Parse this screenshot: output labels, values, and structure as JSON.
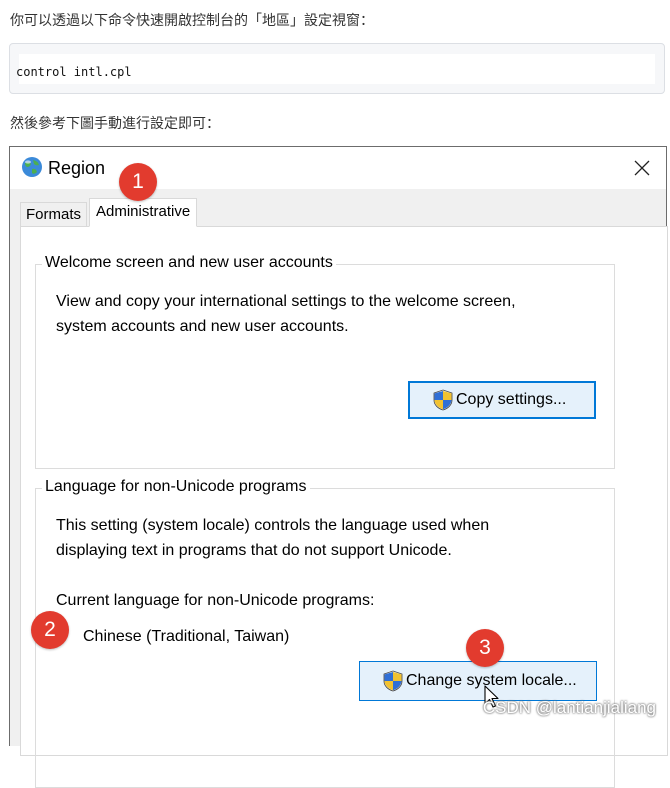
{
  "article": {
    "intro": "你可以透過以下命令快速開啟控制台的「地區」設定視窗：",
    "code": "control intl.cpl",
    "outro": "然後參考下圖手動進行設定即可："
  },
  "dialog": {
    "title": "Region",
    "tabs": [
      {
        "label": "Formats",
        "active": false
      },
      {
        "label": "Administrative",
        "active": true
      }
    ],
    "welcome_group": {
      "legend": "Welcome screen and new user accounts",
      "description_line1": "View and copy your international settings to the welcome screen,",
      "description_line2": "system accounts and new user accounts.",
      "button_label": "Copy settings..."
    },
    "unicode_group": {
      "legend": "Language for non-Unicode programs",
      "description_line1": "This setting (system locale) controls the language used when",
      "description_line2": "displaying text in programs that do not support Unicode.",
      "current_label": "Current language for non-Unicode programs:",
      "current_value": "Chinese (Traditional, Taiwan)",
      "button_label": "Change system locale..."
    }
  },
  "annotations": [
    "1",
    "2",
    "3"
  ],
  "watermark": "CSDN @lantianjialiang",
  "colors": {
    "marker": "#e23b2e",
    "focus_border": "#0078d7",
    "button_bg": "#e5f1fb"
  },
  "icons": [
    "globe-icon",
    "close-icon",
    "uac-shield-icon",
    "mouse-cursor-icon"
  ]
}
